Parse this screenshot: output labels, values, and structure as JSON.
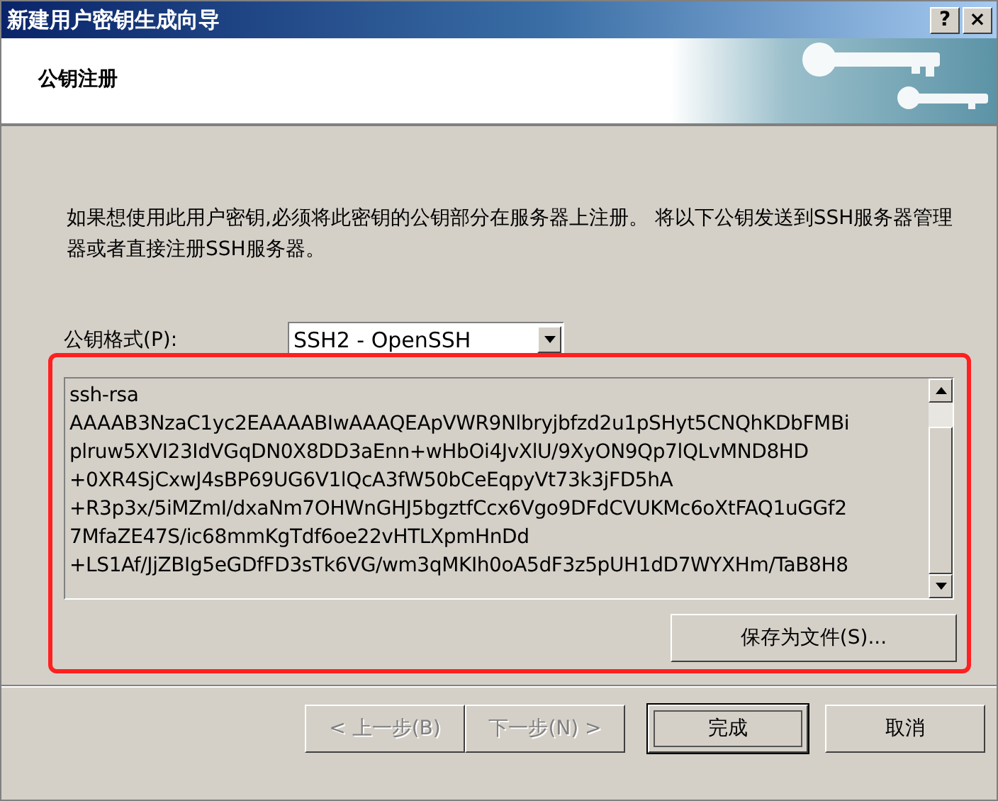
{
  "window": {
    "title": "新建用户密钥生成向导",
    "help_button": "?",
    "close_button": "×"
  },
  "header": {
    "title": "公钥注册"
  },
  "description": "如果想使用此用户密钥,必须将此密钥的公钥部分在服务器上注册。 将以下公钥发送到SSH服务器管理器或者直接注册SSH服务器。",
  "format": {
    "label": "公钥格式(P):",
    "value": "SSH2 - OpenSSH"
  },
  "public_key": {
    "value": "ssh-rsa\nAAAAB3NzaC1yc2EAAAABIwAAAQEApVWR9Nlbryjbfzd2u1pSHyt5CNQhKDbFMBi\nplruw5XVI23IdVGqDN0X8DD3aEnn+wHbOi4JvXlU/9XyON9Qp7lQLvMND8HD\n+0XR4SjCxwJ4sBP69UG6V1lQcA3fW50bCeEqpyVt73k3jFD5hA\n+R3p3x/5iMZmI/dxaNm7OHWnGHJ5bgztfCcx6Vgo9DFdCVUKMc6oXtFAQ1uGGf2\n7MfaZE47S/ic68mmKgTdf6oe22vHTLXpmHnDd\n+LS1Af/JjZBIg5eGDfFD3sTk6VG/wm3qMKIh0oA5dF3z5pUH1dD7WYXHm/TaB8H8"
  },
  "save_button": "保存为文件(S)...",
  "buttons": [
    {
      "label": "< 上一步(B)",
      "disabled": true,
      "default": false
    },
    {
      "label": "下一步(N) >",
      "disabled": true,
      "default": false
    },
    {
      "label": "完成",
      "disabled": false,
      "default": true
    },
    {
      "label": "取消",
      "disabled": false,
      "default": false
    }
  ]
}
